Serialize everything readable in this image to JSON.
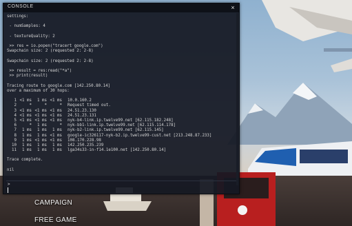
{
  "window": {
    "title": "CONSOLE",
    "close_glyph": "×"
  },
  "console_lines": [
    "settings:",
    "",
    " - numSamples: 4",
    "",
    " - textureQuality: 2",
    "",
    " >> res = io.popen(\"tracert google.com\")",
    "Swapchain size: 2 (requested 2: 2-8)",
    "",
    "Swapchain size: 2 (requested 2: 2-8)",
    "",
    " >> result = res:read(\"*a\")",
    " >> print(result)",
    "",
    "Tracing route to google.com [142.250.80.14]",
    "over a maximum of 30 hops:",
    ""
  ],
  "hops": [
    [
      "1",
      "<1 ms",
      "1 ms",
      "<1 ms",
      "10.0.160.2"
    ],
    [
      "2",
      "*",
      "*",
      "*",
      "Request timed out."
    ],
    [
      "3",
      "<1 ms",
      "<1 ms",
      "<1 ms",
      "24.51.23.130"
    ],
    [
      "4",
      "<1 ms",
      "<1 ms",
      "<1 ms",
      "24.51.23.131"
    ],
    [
      "5",
      "<1 ms",
      "<1 ms",
      "<1 ms",
      "nyk-b4-link.ip.twelve99.net [62.115.182.248]"
    ],
    [
      "6",
      "*",
      "1 ms",
      "*",
      "nyk-bb1-link.ip.twelve99.net [62.115.114.178]"
    ],
    [
      "7",
      "1 ms",
      "1 ms",
      "1 ms",
      "nyk-b2-link.ip.twelve99.net [62.115.145]"
    ],
    [
      "8",
      "1 ms",
      "1 ms",
      "<1 ms",
      "google-ic326117-nyk-b2.ip.twelve99-cust.net [213.248.87.233]"
    ],
    [
      "9",
      "1 ms",
      "<1 ms",
      "<1 ms",
      "108.170.228.98"
    ],
    [
      "10",
      "1 ms",
      "1 ms",
      "1 ms",
      "142.250.235.239"
    ],
    [
      "11",
      "1 ms",
      "1 ms",
      "1 ms",
      "lga34s33-in-f14.1e100.net [142.250.80.14]"
    ]
  ],
  "footer_lines": [
    "",
    "Trace complete.",
    "",
    "nil"
  ],
  "input": {
    "prompt": ">",
    "value": ""
  },
  "menu": {
    "campaign": "CAMPAIGN",
    "free_game": "FREE GAME"
  }
}
